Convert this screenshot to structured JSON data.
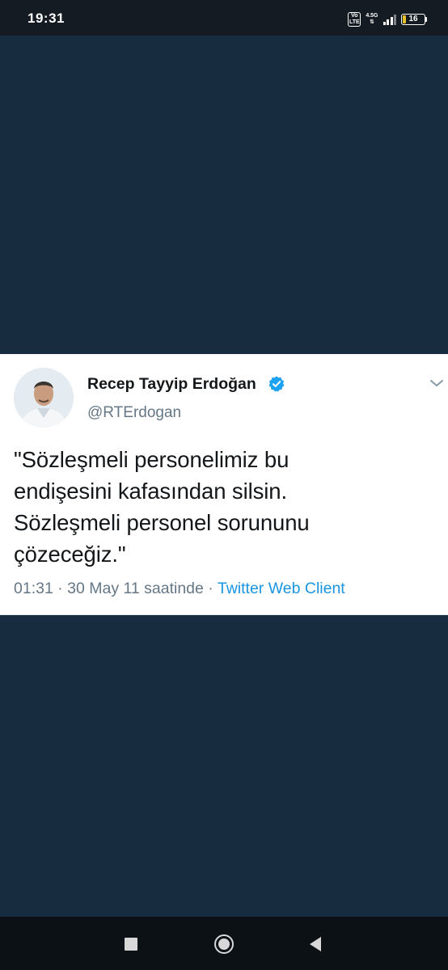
{
  "status_bar": {
    "time": "19:31",
    "volte_label": "Vo LTE",
    "network_type": "4.5G",
    "battery_level": "16",
    "battery_color": "#e8c12a"
  },
  "tweet": {
    "author_name": "Recep Tayyip Erdoğan",
    "verified_icon": "verified-badge-icon",
    "handle": "@RTErdogan",
    "text_lines": [
      "\"Sözleşmeli personelimiz bu",
      "endişesini kafasından silsin.",
      "Sözleşmeli personel sorununu",
      "çözeceğiz.\""
    ],
    "timestamp": "01:31 · 30 May 11 saatinde · ",
    "client": "Twitter Web Client",
    "more_icon": "chevron-down-icon",
    "link_color": "#1b95e0"
  },
  "nav_bar": {
    "recents_icon": "square-icon",
    "home_icon": "circle-icon",
    "back_icon": "triangle-back-icon"
  }
}
